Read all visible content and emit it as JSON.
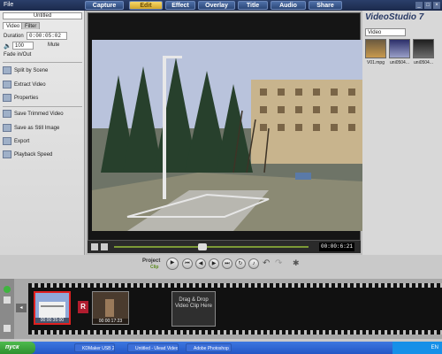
{
  "menu": {
    "file_label": "File",
    "tabs": [
      {
        "label": "Capture",
        "active": false
      },
      {
        "label": "Edit",
        "active": true
      },
      {
        "label": "Effect",
        "active": false
      },
      {
        "label": "Overlay",
        "active": false
      },
      {
        "label": "Title",
        "active": false
      },
      {
        "label": "Audio",
        "active": false
      },
      {
        "label": "Share",
        "active": false
      }
    ]
  },
  "options_panel": {
    "project_title": "Untitled",
    "tabs": [
      "Video",
      "Filter"
    ],
    "duration_label": "Duration",
    "duration_value": "0:00:05:02",
    "volume_value": "100",
    "mute_label": "Mute",
    "fade_label": "Fade in/Out",
    "actions": [
      "Split by Scene",
      "Extract Video",
      "Properties",
      "Save Trimmed Video",
      "Save as Still Image",
      "Export",
      "Playback Speed"
    ]
  },
  "preview": {
    "timecode": "00:00:6:21"
  },
  "library": {
    "brand": "VideoStudio 7",
    "category": "Video",
    "thumbnails": [
      "V01.mpg",
      "uni0504...",
      "uni0504..."
    ]
  },
  "playback": {
    "project_label": "Project",
    "clip_label": "Clip"
  },
  "timeline": {
    "clips": [
      {
        "time": "00:00:35:00"
      },
      {
        "time": "00:00:17:23"
      }
    ],
    "drop_text": "Drag & Drop Video Clip Here"
  },
  "taskbar": {
    "start_label": "пуск",
    "tasks": [
      "KDMaker USB 2.0",
      "Untitled - Ulead Video...",
      "Adobe Photoshop"
    ],
    "clock": "EN"
  },
  "colors": {
    "menubar": "#1b2a4c",
    "active_tab": "#f6d86b",
    "scrub": "#7c9a36",
    "selected_clip_border": "#e02020"
  }
}
